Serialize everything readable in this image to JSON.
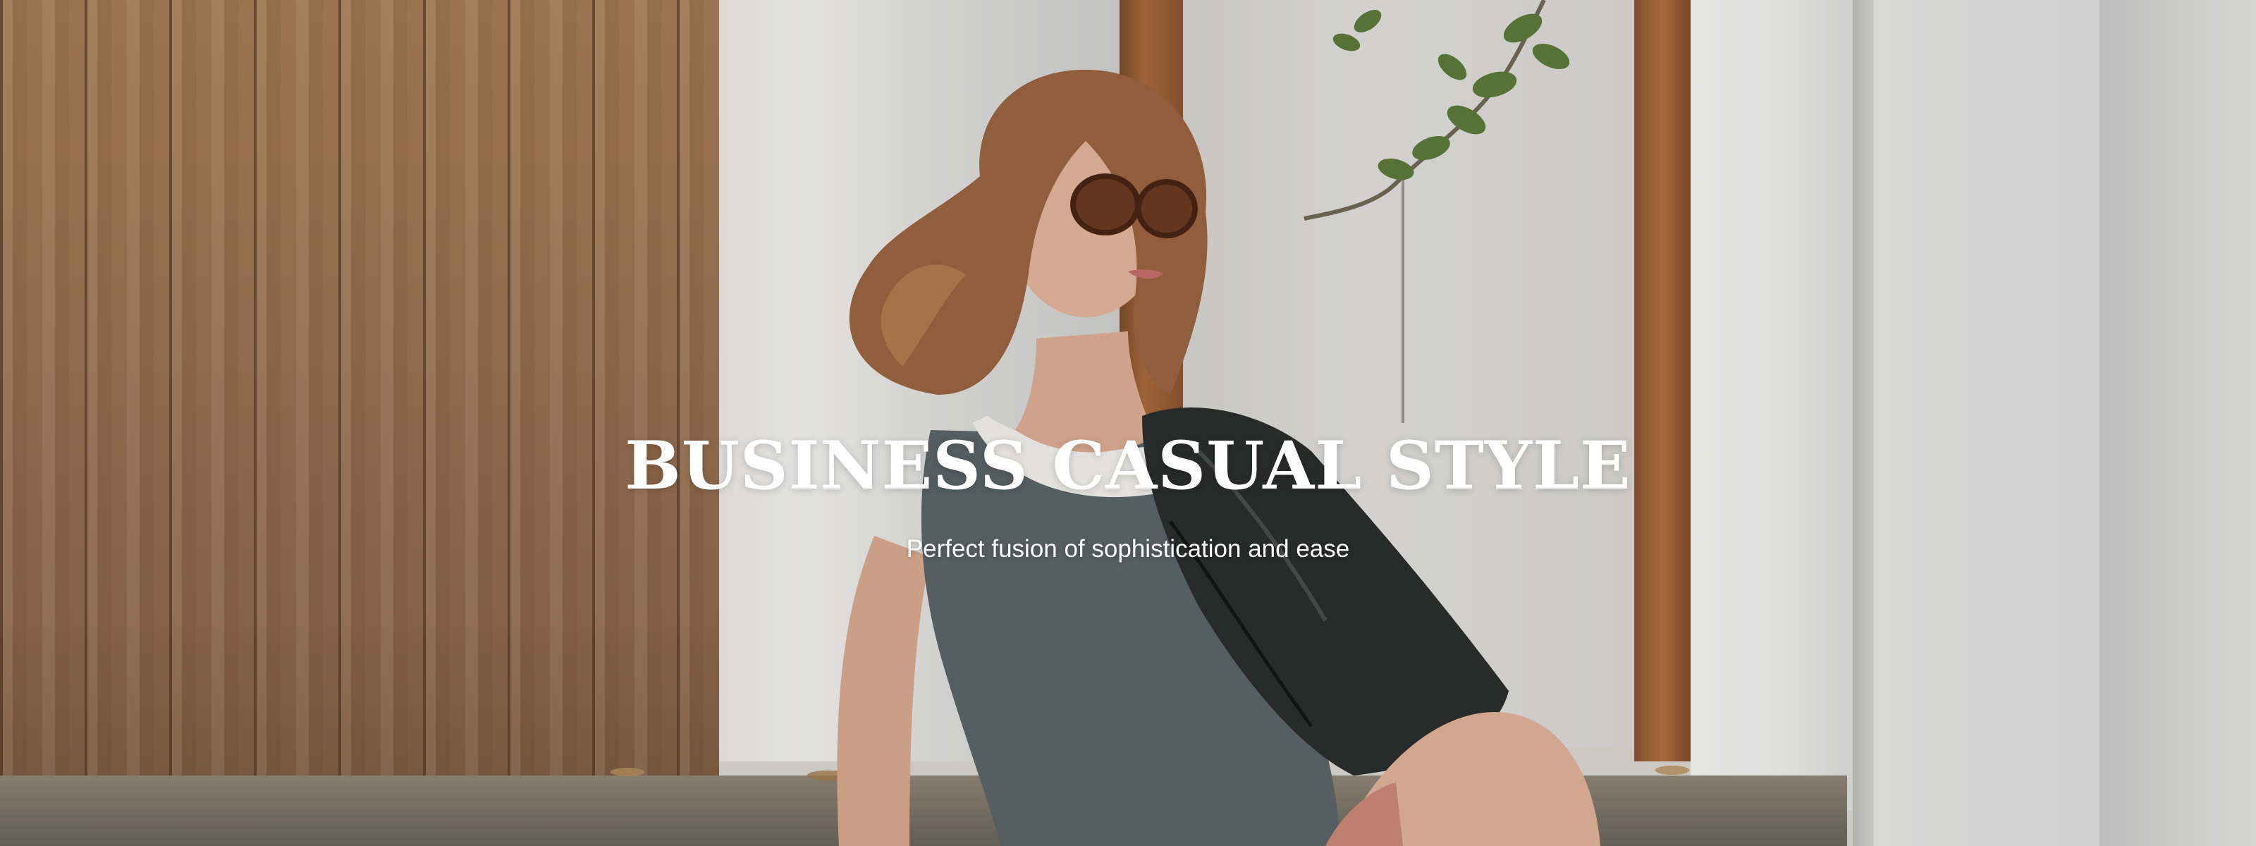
{
  "hero": {
    "headline": "BUSINESS CASUAL STYLE",
    "subheadline": "Perfect fusion of sophistication and ease",
    "text_color": "#ffffff"
  }
}
